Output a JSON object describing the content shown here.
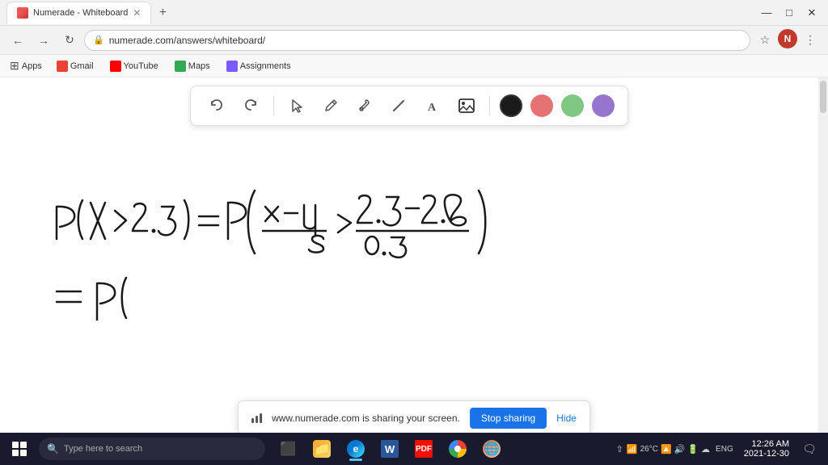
{
  "browser": {
    "tab": {
      "title": "Numerade - Whiteboard",
      "favicon": "N"
    },
    "url": "numerade.com/answers/whiteboard/",
    "window_controls": {
      "minimize": "—",
      "maximize": "□",
      "close": "✕"
    }
  },
  "bookmarks": {
    "apps_label": "Apps",
    "items": [
      {
        "name": "Gmail",
        "icon_type": "gmail"
      },
      {
        "name": "YouTube",
        "icon_type": "youtube"
      },
      {
        "name": "Maps",
        "icon_type": "maps"
      },
      {
        "name": "Assignments",
        "icon_type": "assignments"
      }
    ]
  },
  "toolbar": {
    "undo_label": "↺",
    "redo_label": "↻",
    "select_label": "⬡",
    "pen_label": "✏",
    "tools_label": "⚙",
    "line_label": "/",
    "text_label": "A",
    "image_label": "🖼",
    "colors": [
      {
        "name": "black",
        "hex": "#1a1a1a"
      },
      {
        "name": "red",
        "hex": "#e57373"
      },
      {
        "name": "green",
        "hex": "#81c784"
      },
      {
        "name": "purple",
        "hex": "#9575cd"
      }
    ]
  },
  "sharing_banner": {
    "message": "www.numerade.com is sharing your screen.",
    "stop_label": "Stop sharing",
    "hide_label": "Hide"
  },
  "taskbar": {
    "search_placeholder": "Type here to search",
    "clock": "12:26 AM",
    "date": "2021-12-30",
    "language": "ENG",
    "temp": "26°C"
  }
}
